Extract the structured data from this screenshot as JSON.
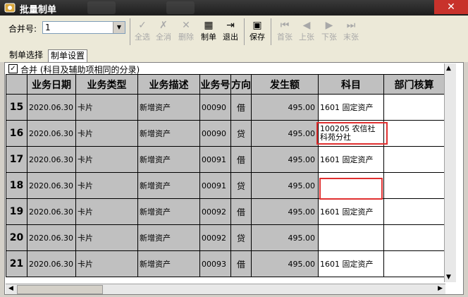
{
  "window": {
    "title": "批量制单",
    "close_glyph": "✕"
  },
  "toolbar": {
    "merge_label": "合并号:",
    "merge_value": "1",
    "buttons": [
      {
        "icon": "✓",
        "label": "全选",
        "enabled": false
      },
      {
        "icon": "✗",
        "label": "全消",
        "enabled": false
      },
      {
        "icon": "✕",
        "label": "删除",
        "enabled": false
      },
      {
        "icon": "▦",
        "label": "制单",
        "enabled": true
      },
      {
        "icon": "⇥",
        "label": "退出",
        "enabled": true
      },
      {
        "icon": "▣",
        "label": "保存",
        "enabled": true
      },
      {
        "icon": "⏮",
        "label": "首张",
        "enabled": false
      },
      {
        "icon": "◀",
        "label": "上张",
        "enabled": false
      },
      {
        "icon": "▶",
        "label": "下张",
        "enabled": false
      },
      {
        "icon": "⏭",
        "label": "末张",
        "enabled": false
      }
    ]
  },
  "tabs": [
    "制单选择",
    "制单设置"
  ],
  "merge_checkbox": {
    "checked": true,
    "label": "合并 (科目及辅助项相同的分录)"
  },
  "grid": {
    "headers": [
      "",
      "业务日期",
      "业务类型",
      "业务描述",
      "业务号",
      "方向",
      "发生额",
      "科目",
      "部门核算"
    ],
    "rows": [
      {
        "num": "15",
        "date": "2020.06.30",
        "type": "卡片",
        "desc": "新增资产",
        "bizno": "00090",
        "dir": "借",
        "amount": "495.00",
        "subject": "1601  固定资产"
      },
      {
        "num": "16",
        "date": "2020.06.30",
        "type": "卡片",
        "desc": "新增资产",
        "bizno": "00090",
        "dir": "贷",
        "amount": "495.00",
        "subject": "100205  农信社",
        "subject2": "科苑分社"
      },
      {
        "num": "17",
        "date": "2020.06.30",
        "type": "卡片",
        "desc": "新增资产",
        "bizno": "00091",
        "dir": "借",
        "amount": "495.00",
        "subject": "1601  固定资产"
      },
      {
        "num": "18",
        "date": "2020.06.30",
        "type": "卡片",
        "desc": "新增资产",
        "bizno": "00091",
        "dir": "贷",
        "amount": "495.00",
        "subject": ""
      },
      {
        "num": "19",
        "date": "2020.06.30",
        "type": "卡片",
        "desc": "新增资产",
        "bizno": "00092",
        "dir": "借",
        "amount": "495.00",
        "subject": "1601  固定资产"
      },
      {
        "num": "20",
        "date": "2020.06.30",
        "type": "卡片",
        "desc": "新增资产",
        "bizno": "00092",
        "dir": "贷",
        "amount": "495.00",
        "subject": ""
      },
      {
        "num": "21",
        "date": "2020.06.30",
        "type": "卡片",
        "desc": "新增资产",
        "bizno": "00093",
        "dir": "借",
        "amount": "495.00",
        "subject": "1601  固定资产"
      }
    ]
  }
}
